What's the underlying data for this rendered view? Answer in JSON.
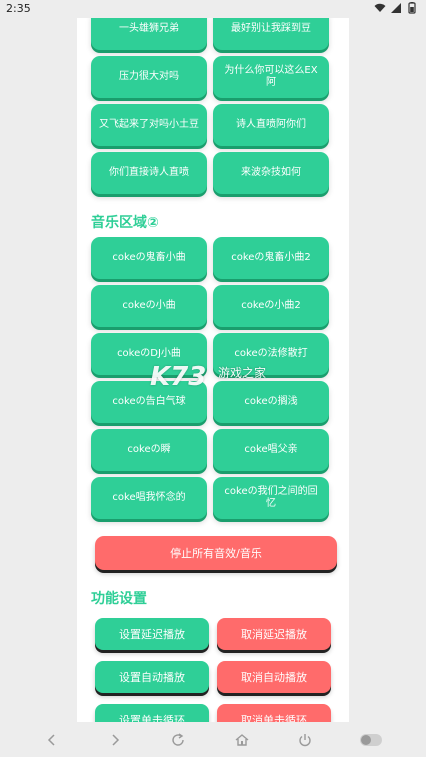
{
  "status_bar": {
    "time": "2:35"
  },
  "top_buttons": [
    "一头雄狮兄弟",
    "最好别让我踩到豆",
    "压力很大对吗",
    "为什么你可以这么EX阿",
    "又飞起来了对吗小土豆",
    "诗人直喷阿你们",
    "你们直接诗人直喷",
    "来波杂技如何"
  ],
  "music_section": {
    "title": "音乐区域②",
    "buttons": [
      "cokeの鬼畜小曲",
      "cokeの鬼畜小曲2",
      "cokeの小曲",
      "cokeの小曲2",
      "cokeのDJ小曲",
      "cokeの法修散打",
      "cokeの告白气球",
      "cokeの搁浅",
      "cokeの瞬",
      "coke唱父亲",
      "coke唱我怀念的",
      "cokeの我们之间的回忆"
    ]
  },
  "stop_all_label": "停止所有音效/音乐",
  "settings_section": {
    "title": "功能设置",
    "rows": [
      {
        "set": "设置延迟播放",
        "cancel": "取消延迟播放"
      },
      {
        "set": "设置自动播放",
        "cancel": "取消自动播放"
      },
      {
        "set": "设置单击循环",
        "cancel": "取消单击循环"
      }
    ]
  },
  "watermark": {
    "logo": "K73",
    "text": "游戏之家"
  },
  "colors": {
    "accent_green": "#2fcf97",
    "accent_red": "#ff6b6b"
  }
}
